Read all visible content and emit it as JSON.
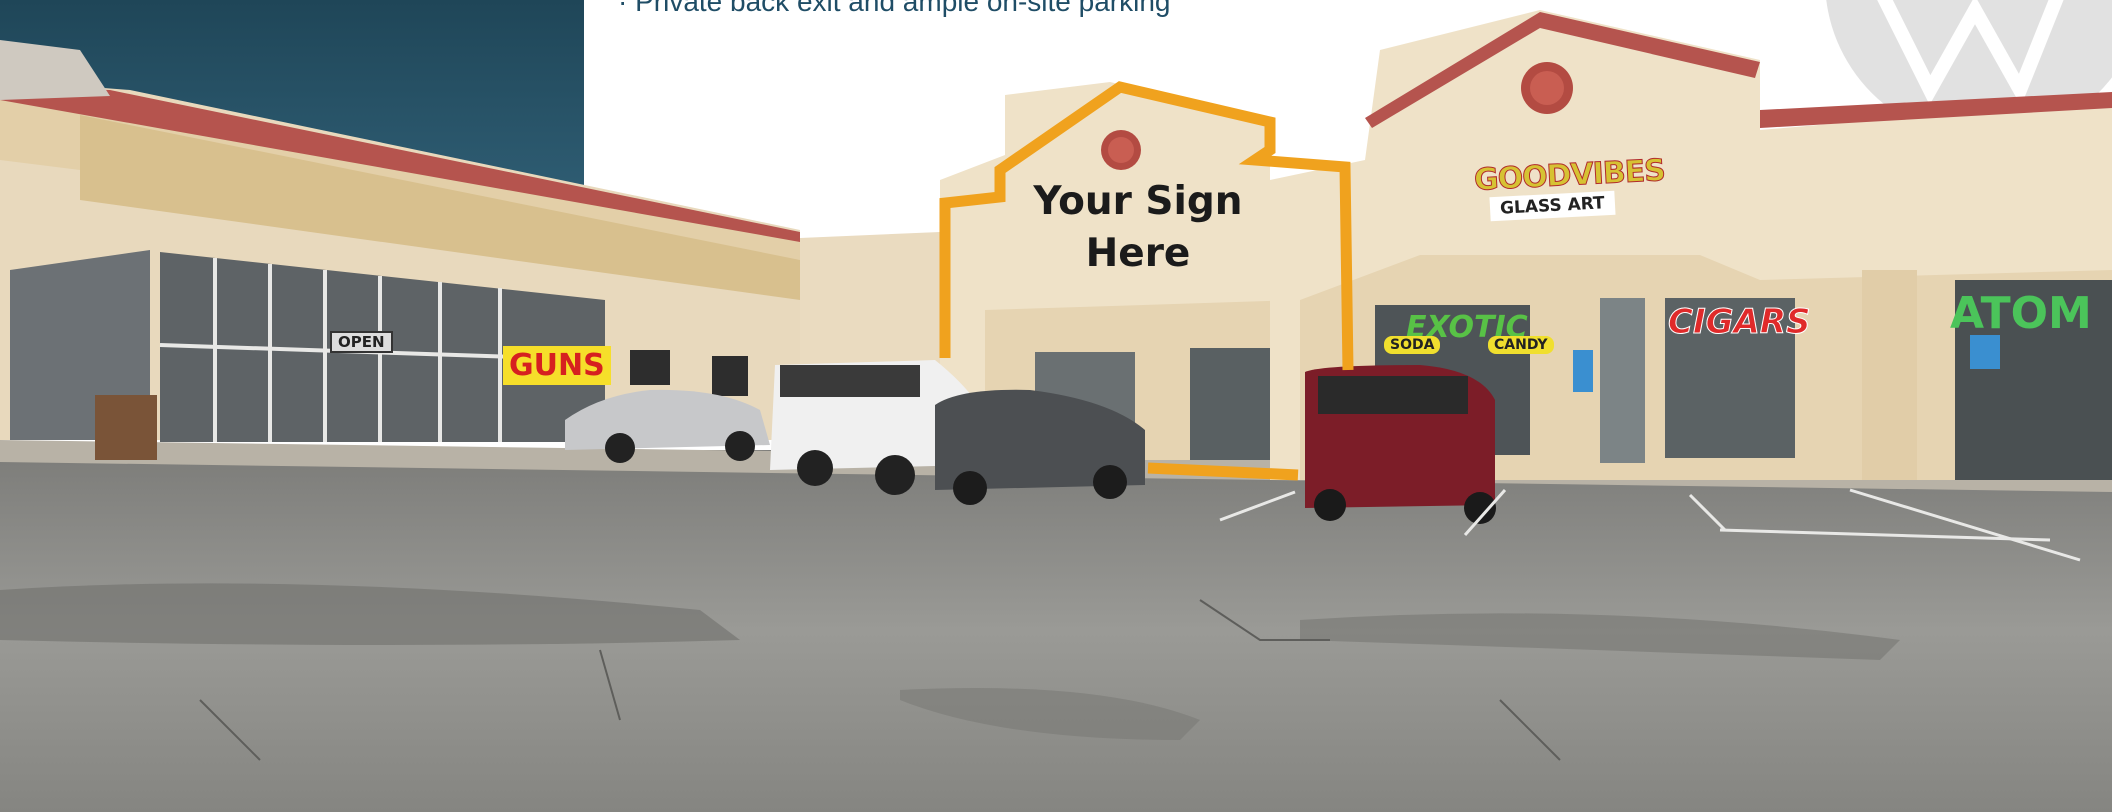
{
  "bullet_text": "· Private back exit and ample on-site parking",
  "sign_placeholder": [
    "Your Sign",
    "Here"
  ],
  "storefronts": {
    "goodvibes": "GOODVIBES",
    "glass_art": "GLASS ART",
    "guns": "GUNS",
    "exotic": "EXOTIC",
    "soda": "SODA",
    "candy": "CANDY",
    "cigars": "CIGARS",
    "atom": "ATOM",
    "open": "OPEN"
  },
  "colors": {
    "sky_panel": "#254e63",
    "outline": "#f0a21e",
    "stucco": "#e9dcc2",
    "trim": "#d6bf8a",
    "roof": "#b5544e",
    "asphalt": "#8d8d8a"
  }
}
